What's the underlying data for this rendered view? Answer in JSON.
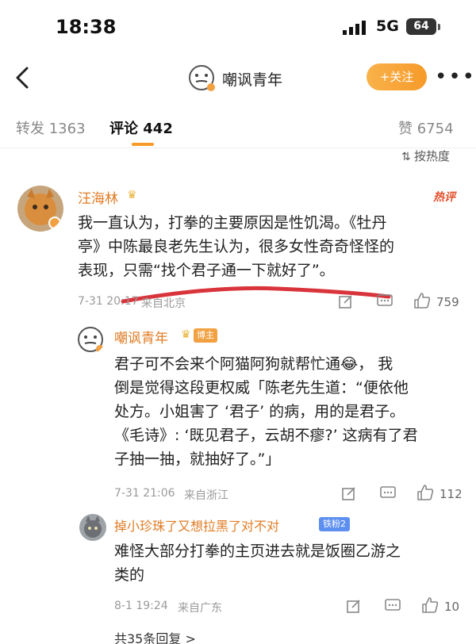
{
  "status_bar": {
    "time": "18:38",
    "network": "5G",
    "battery": "64"
  },
  "nav": {
    "title": "嘲讽青年",
    "follow_label": "+关注",
    "more_label": "•••"
  },
  "tabs": {
    "repost": "转发 1363",
    "comment": "评论 442",
    "like": "赞 6754",
    "sort_label": "按热度"
  },
  "comments": [
    {
      "name": "汪海林",
      "hot_badge": "热评",
      "lines": [
        "我一直认为，打拳的主要原因是性饥渴。《牡丹",
        "亭》中陈最良老先生认为，很多女性奇奇怪怪的",
        "表现，只需“找个君子通一下就好了”。"
      ],
      "date": "7-31 20:17",
      "location": "来自北京",
      "likes": "759"
    },
    {
      "name": "嘲讽青年",
      "author_tag": "博主",
      "lines": [
        "君子可不会来个阿猫阿狗就帮忙通😂， 我",
        "倒是觉得这段更权威「陈老先生道：“便依他",
        "处方。小姐害了 ‘君子’ 的病，用的是君子。",
        "《毛诗》: ‘既见君子，云胡不瘳?’ 这病有了君",
        "子抽一抽，就抽好了。”」"
      ],
      "date": "7-31 21:06",
      "location": "来自浙江",
      "likes": "112"
    },
    {
      "name": "掉小珍珠了又想拉黑了对不对",
      "fan_tag": "铁粉2",
      "lines": [
        "难怪大部分打拳的主页进去就是饭圈乙游之",
        "类的"
      ],
      "date": "8-1 19:24",
      "location": "来自广东",
      "likes": "10"
    }
  ],
  "reply_all": "共35条回复 >",
  "colors": {
    "accent": "#f79a2a",
    "name": "#e07b23",
    "hot": "#e4502c",
    "red_underline": "#d9343b"
  }
}
